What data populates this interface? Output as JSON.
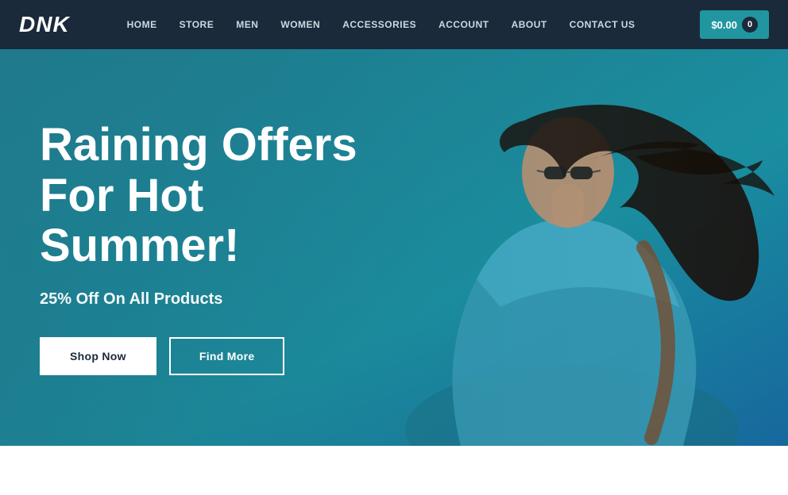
{
  "brand": "DNK",
  "nav": {
    "links": [
      {
        "label": "HOME",
        "id": "home"
      },
      {
        "label": "STORE",
        "id": "store"
      },
      {
        "label": "MEN",
        "id": "men"
      },
      {
        "label": "WOMEN",
        "id": "women"
      },
      {
        "label": "ACCESSORIES",
        "id": "accessories"
      },
      {
        "label": "ACCOUNT",
        "id": "account"
      },
      {
        "label": "ABOUT",
        "id": "about"
      },
      {
        "label": "CONTACT US",
        "id": "contact"
      }
    ],
    "cart_price": "$0.00",
    "cart_count": "0"
  },
  "hero": {
    "title": "Raining Offers For Hot Summer!",
    "subtitle": "25% Off On All Products",
    "btn_shop": "Shop Now",
    "btn_find": "Find More"
  }
}
